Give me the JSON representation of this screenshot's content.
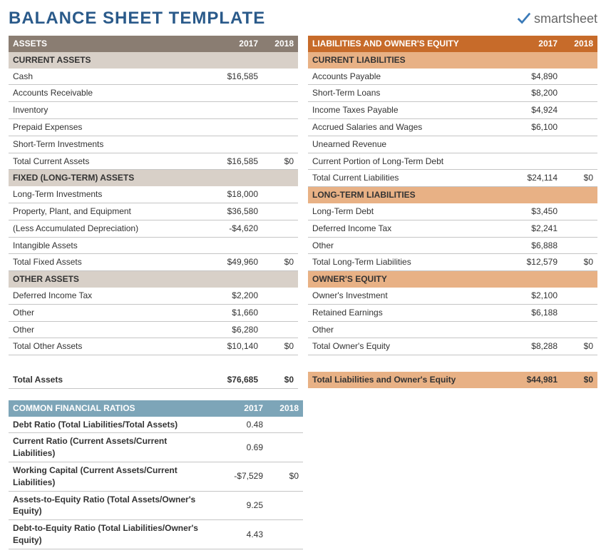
{
  "title": "BALANCE SHEET TEMPLATE",
  "logo": {
    "check": "✓",
    "text": "smartsheet"
  },
  "years": {
    "y1": "2017",
    "y2": "2018"
  },
  "assets": {
    "header": "ASSETS",
    "current": {
      "header": "CURRENT ASSETS",
      "rows": [
        {
          "label": "Cash",
          "v1": "$16,585",
          "v2": ""
        },
        {
          "label": "Accounts Receivable",
          "v1": "",
          "v2": ""
        },
        {
          "label": "Inventory",
          "v1": "",
          "v2": ""
        },
        {
          "label": "Prepaid Expenses",
          "v1": "",
          "v2": ""
        },
        {
          "label": "Short-Term Investments",
          "v1": "",
          "v2": ""
        }
      ],
      "total": {
        "label": "Total Current Assets",
        "v1": "$16,585",
        "v2": "$0"
      }
    },
    "fixed": {
      "header": "FIXED (LONG-TERM) ASSETS",
      "rows": [
        {
          "label": "Long-Term Investments",
          "v1": "$18,000",
          "v2": ""
        },
        {
          "label": "Property, Plant, and Equipment",
          "v1": "$36,580",
          "v2": ""
        },
        {
          "label": "(Less Accumulated Depreciation)",
          "v1": "-$4,620",
          "v2": ""
        },
        {
          "label": "Intangible Assets",
          "v1": "",
          "v2": ""
        }
      ],
      "total": {
        "label": "Total Fixed Assets",
        "v1": "$49,960",
        "v2": "$0"
      }
    },
    "other": {
      "header": "OTHER ASSETS",
      "rows": [
        {
          "label": "Deferred Income Tax",
          "v1": "$2,200",
          "v2": ""
        },
        {
          "label": "Other",
          "v1": "$1,660",
          "v2": ""
        },
        {
          "label": "Other",
          "v1": "$6,280",
          "v2": ""
        }
      ],
      "total": {
        "label": "Total Other Assets",
        "v1": "$10,140",
        "v2": "$0"
      }
    },
    "grand": {
      "label": "Total Assets",
      "v1": "$76,685",
      "v2": "$0"
    }
  },
  "liabilities": {
    "header": "LIABILITIES AND OWNER'S EQUITY",
    "current": {
      "header": "CURRENT LIABILITIES",
      "rows": [
        {
          "label": "Accounts Payable",
          "v1": "$4,890",
          "v2": ""
        },
        {
          "label": "Short-Term Loans",
          "v1": "$8,200",
          "v2": ""
        },
        {
          "label": "Income Taxes Payable",
          "v1": "$4,924",
          "v2": ""
        },
        {
          "label": "Accrued Salaries and Wages",
          "v1": "$6,100",
          "v2": ""
        },
        {
          "label": "Unearned Revenue",
          "v1": "",
          "v2": ""
        },
        {
          "label": "Current Portion of Long-Term Debt",
          "v1": "",
          "v2": ""
        }
      ],
      "total": {
        "label": "Total Current Liabilities",
        "v1": "$24,114",
        "v2": "$0"
      }
    },
    "longterm": {
      "header": "LONG-TERM LIABILITIES",
      "rows": [
        {
          "label": "Long-Term Debt",
          "v1": "$3,450",
          "v2": ""
        },
        {
          "label": "Deferred Income Tax",
          "v1": "$2,241",
          "v2": ""
        },
        {
          "label": "Other",
          "v1": "$6,888",
          "v2": ""
        }
      ],
      "total": {
        "label": "Total Long-Term Liabilities",
        "v1": "$12,579",
        "v2": "$0"
      }
    },
    "equity": {
      "header": "OWNER'S EQUITY",
      "rows": [
        {
          "label": "Owner's Investment",
          "v1": "$2,100",
          "v2": ""
        },
        {
          "label": "Retained Earnings",
          "v1": "$6,188",
          "v2": ""
        },
        {
          "label": "Other",
          "v1": "",
          "v2": ""
        }
      ],
      "total": {
        "label": "Total Owner's Equity",
        "v1": "$8,288",
        "v2": "$0"
      }
    },
    "grand": {
      "label": "Total Liabilities and Owner's Equity",
      "v1": "$44,981",
      "v2": "$0"
    }
  },
  "ratios": {
    "header": "COMMON FINANCIAL RATIOS",
    "rows": [
      {
        "label": "Debt Ratio (Total Liabilities/Total Assets)",
        "v1": "0.48",
        "v2": ""
      },
      {
        "label": "Current Ratio (Current Assets/Current Liabilities)",
        "v1": "0.69",
        "v2": ""
      },
      {
        "label": "Working Capital (Current Assets/Current Liabilities)",
        "v1": "-$7,529",
        "v2": "$0"
      },
      {
        "label": "Assets-to-Equity Ratio (Total Assets/Owner's Equity)",
        "v1": "9.25",
        "v2": ""
      },
      {
        "label": "Debt-to-Equity Ratio (Total Liabilities/Owner's Equity)",
        "v1": "4.43",
        "v2": ""
      }
    ]
  }
}
